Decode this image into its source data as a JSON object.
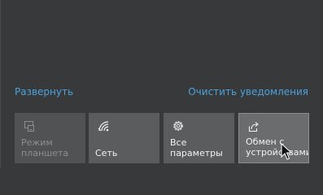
{
  "action_center": {
    "expand_label": "Развернуть",
    "clear_label": "Очистить уведомления"
  },
  "quick_actions": [
    {
      "label": "Режим\nпланшета",
      "icon": "tablet-mode-icon",
      "enabled": false
    },
    {
      "label": "Сеть",
      "icon": "network-icon",
      "enabled": true
    },
    {
      "label": "Все параметры",
      "icon": "gear-icon",
      "enabled": true
    },
    {
      "label": "Обмен с\nустройствами",
      "icon": "share-icon",
      "enabled": true,
      "hovered": true
    }
  ],
  "colors": {
    "background": "#37393b",
    "accent_link": "#4ea2dc",
    "tile": "#5a5c5e",
    "tile_disabled": "#505254",
    "tile_hover": "#6a6c6e"
  }
}
